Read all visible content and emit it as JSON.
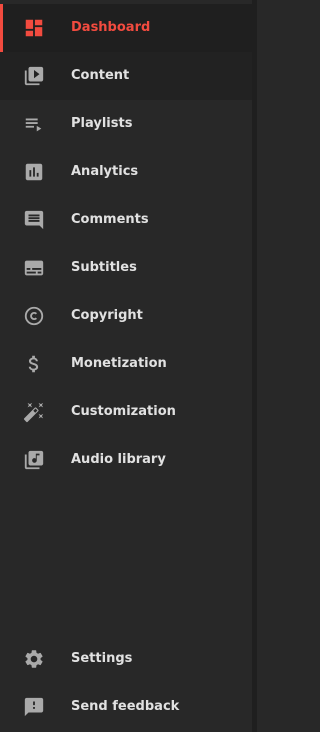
{
  "colors": {
    "background": "#282828",
    "active": "#f24b3f",
    "text": "#e1e1e1",
    "icon": "#aaaaaa"
  },
  "nav": {
    "items": [
      {
        "label": "Dashboard",
        "icon": "dashboard-icon",
        "active": true
      },
      {
        "label": "Content",
        "icon": "content-icon"
      },
      {
        "label": "Playlists",
        "icon": "playlists-icon"
      },
      {
        "label": "Analytics",
        "icon": "analytics-icon"
      },
      {
        "label": "Comments",
        "icon": "comments-icon"
      },
      {
        "label": "Subtitles",
        "icon": "subtitles-icon"
      },
      {
        "label": "Copyright",
        "icon": "copyright-icon"
      },
      {
        "label": "Monetization",
        "icon": "monetization-icon"
      },
      {
        "label": "Customization",
        "icon": "customization-icon"
      },
      {
        "label": "Audio library",
        "icon": "audio-library-icon"
      }
    ],
    "footer_items": [
      {
        "label": "Settings",
        "icon": "settings-icon"
      },
      {
        "label": "Send feedback",
        "icon": "feedback-icon"
      }
    ]
  }
}
